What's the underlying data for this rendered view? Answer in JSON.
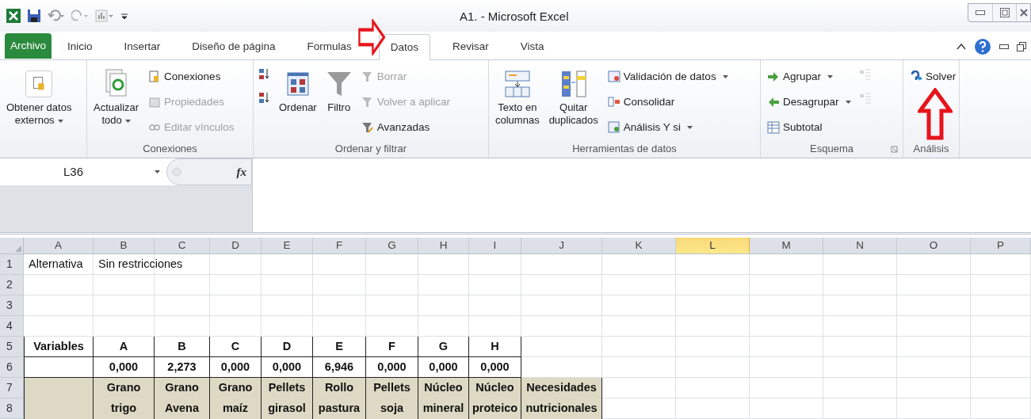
{
  "title_bar": {
    "title": "A1. - Microsoft Excel"
  },
  "tabs": [
    {
      "label": "Archivo",
      "kind": "file",
      "selected": false
    },
    {
      "label": "Inicio",
      "kind": "tab",
      "selected": false
    },
    {
      "label": "Insertar",
      "kind": "tab",
      "selected": false
    },
    {
      "label": "Diseño de página",
      "kind": "tab",
      "selected": false
    },
    {
      "label": "Formulas",
      "kind": "tab",
      "selected": false
    },
    {
      "label": "Datos",
      "kind": "tab",
      "selected": true
    },
    {
      "label": "Revisar",
      "kind": "tab",
      "selected": false
    },
    {
      "label": "Vista",
      "kind": "tab",
      "selected": false
    }
  ],
  "ribbon": {
    "groups": [
      {
        "items": [
          {
            "kind": "large",
            "lines": [
              "Obtener datos",
              "externos"
            ],
            "dropdown": true,
            "disabled": false
          }
        ]
      },
      {
        "label": "Conexiones",
        "items": [
          {
            "kind": "large",
            "lines": [
              "Actualizar",
              "todo"
            ],
            "dropdown": true,
            "disabled": false
          },
          {
            "kind": "small",
            "label": "Conexiones",
            "dropdown": false,
            "disabled": false
          },
          {
            "kind": "small",
            "label": "Propiedades",
            "dropdown": false,
            "disabled": true
          },
          {
            "kind": "small",
            "label": "Editar vínculos",
            "dropdown": false,
            "disabled": true
          }
        ]
      },
      {
        "label": "Ordenar y filtrar",
        "items": [
          {
            "kind": "icon",
            "disabled": false
          },
          {
            "kind": "icon",
            "disabled": false
          },
          {
            "kind": "large",
            "lines": [
              "Ordenar"
            ],
            "dropdown": false,
            "disabled": false
          },
          {
            "kind": "large",
            "lines": [
              "Filtro"
            ],
            "dropdown": false,
            "disabled": false
          },
          {
            "kind": "small",
            "label": "Borrar",
            "dropdown": false,
            "disabled": true
          },
          {
            "kind": "small",
            "label": "Volver a aplicar",
            "dropdown": false,
            "disabled": true
          },
          {
            "kind": "small",
            "label": "Avanzadas",
            "dropdown": false,
            "disabled": false
          }
        ]
      },
      {
        "label": "Herramientas de datos",
        "items": [
          {
            "kind": "large",
            "lines": [
              "Texto en",
              "columnas"
            ],
            "dropdown": false,
            "disabled": false
          },
          {
            "kind": "large",
            "lines": [
              "Quitar",
              "duplicados"
            ],
            "dropdown": false,
            "disabled": false
          },
          {
            "kind": "small",
            "label": "Validación de datos",
            "dropdown": true,
            "disabled": false
          },
          {
            "kind": "small",
            "label": "Consolidar",
            "dropdown": false,
            "disabled": false
          },
          {
            "kind": "small",
            "label": "Análisis Y si",
            "dropdown": true,
            "disabled": false
          }
        ]
      },
      {
        "label": "Esquema",
        "launcher": true,
        "items": [
          {
            "kind": "small",
            "label": "Agrupar",
            "dropdown": true,
            "disabled": false
          },
          {
            "kind": "small",
            "label": "Desagrupar",
            "dropdown": true,
            "disabled": false
          },
          {
            "kind": "small",
            "label": "Subtotal",
            "dropdown": false,
            "disabled": false
          },
          {
            "kind": "icon",
            "disabled": true
          },
          {
            "kind": "icon",
            "disabled": true
          }
        ]
      },
      {
        "label": "Análisis",
        "items": [
          {
            "kind": "small",
            "label": "Solver",
            "dropdown": false,
            "disabled": false
          }
        ]
      }
    ]
  },
  "formula_bar": {
    "name_box": "L36",
    "function_label": "fx"
  },
  "sheet": {
    "columns": [
      {
        "label": "A",
        "selected": false
      },
      {
        "label": "B",
        "selected": false
      },
      {
        "label": "C",
        "selected": false
      },
      {
        "label": "D",
        "selected": false
      },
      {
        "label": "E",
        "selected": false
      },
      {
        "label": "F",
        "selected": false
      },
      {
        "label": "G",
        "selected": false
      },
      {
        "label": "H",
        "selected": false
      },
      {
        "label": "I",
        "selected": false
      },
      {
        "label": "J",
        "selected": false
      },
      {
        "label": "K",
        "selected": false
      },
      {
        "label": "L",
        "selected": true
      },
      {
        "label": "M",
        "selected": false
      },
      {
        "label": "N",
        "selected": false
      },
      {
        "label": "O",
        "selected": false
      },
      {
        "label": "P",
        "selected": false
      }
    ],
    "rows": [
      {
        "number": "1",
        "kind": "plain",
        "cells": [
          "Alternativa",
          "Sin restricciones"
        ]
      },
      {
        "number": "2",
        "kind": "plain",
        "cells": []
      },
      {
        "number": "3",
        "kind": "plain",
        "cells": []
      },
      {
        "number": "4",
        "kind": "plain",
        "cells": []
      },
      {
        "number": "5",
        "kind": "boxed",
        "cells": [
          "Variables",
          "A",
          "B",
          "C",
          "D",
          "E",
          "F",
          "G",
          "H"
        ]
      },
      {
        "number": "6",
        "kind": "boxed",
        "cells": [
          null,
          "0,000",
          "2,273",
          "0,000",
          "0,000",
          "6,946",
          "0,000",
          "0,000",
          "0,000"
        ]
      },
      {
        "number": "7",
        "kind": "shaded",
        "cells": [
          null,
          "Grano",
          "Grano",
          "Grano",
          "Pellets",
          "Rollo",
          "Pellets",
          "Núcleo",
          "Núcleo",
          "Necesidades"
        ]
      },
      {
        "number": "8",
        "kind": "shaded",
        "cells": [
          null,
          "trigo",
          "Avena",
          "maíz",
          "girasol",
          "pastura",
          "soja",
          "mineral",
          "proteico",
          "nutricionales"
        ]
      }
    ]
  }
}
